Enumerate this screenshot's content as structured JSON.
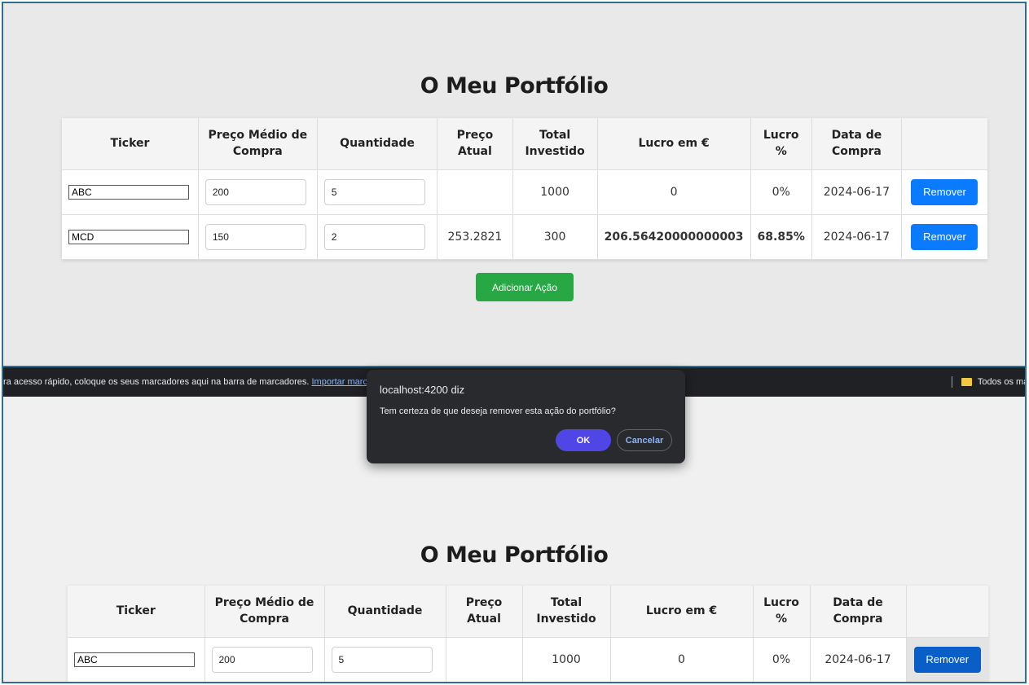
{
  "page": {
    "title": "O Meu Portfólio",
    "add_button": "Adicionar Ação"
  },
  "table": {
    "headers": {
      "ticker": "Ticker",
      "avg_price_1": "Preço Médio de",
      "avg_price_2": "Compra",
      "quantity": "Quantidade",
      "current_price_1": "Preço",
      "current_price_2": "Atual",
      "total_invested_1": "Total",
      "total_invested_2": "Investido",
      "profit_eur": "Lucro em €",
      "profit_pct_1": "Lucro",
      "profit_pct_2": "%",
      "purchase_date_1": "Data de",
      "purchase_date_2": "Compra"
    },
    "rows": [
      {
        "ticker": "ABC",
        "avg_price": "200",
        "quantity": "5",
        "current_price": "",
        "total_invested": "1000",
        "profit_eur": "0",
        "profit_pct": "0%",
        "purchase_date": "2024-06-17",
        "remove_label": "Remover"
      },
      {
        "ticker": "MCD",
        "avg_price": "150",
        "quantity": "2",
        "current_price": "253.2821",
        "total_invested": "300",
        "profit_eur": "206.56420000000003",
        "profit_pct": "68.85%",
        "purchase_date": "2024-06-17",
        "remove_label": "Remover"
      }
    ]
  },
  "browser": {
    "bookmarks_hint": "ra acesso rápido, coloque os seus marcadores aqui na barra de marcadores.",
    "bookmarks_link": "Importar marcadores",
    "folder_label": "Todos os ma"
  },
  "dialog": {
    "title": "localhost:4200 diz",
    "message": "Tem certeza de que deseja remover esta ação do portfólio?",
    "ok": "OK",
    "cancel": "Cancelar"
  },
  "colors": {
    "remove_button": "#0a7bff",
    "add_button": "#28a745",
    "profit_text": "#1f7a1f",
    "dialog_ok": "#4f46e5",
    "dialog_background": "#292a2d"
  }
}
